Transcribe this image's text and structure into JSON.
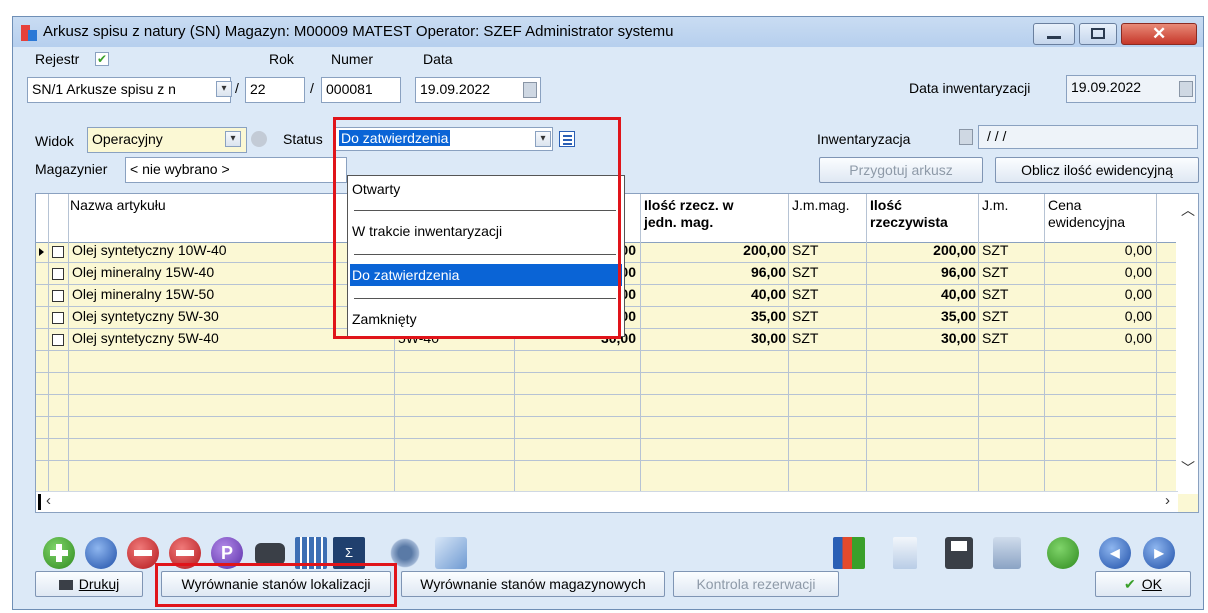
{
  "window": {
    "title": "Arkusz spisu z natury (SN)  Magazyn: M00009 MATEST  Operator: SZEF Administrator systemu"
  },
  "header": {
    "rejestr_label": "Rejestr",
    "rejestr_value": "SN/1 Arkusze spisu z n",
    "rok_label": "Rok",
    "rok_value": "22",
    "numer_label": "Numer",
    "numer_value": "000081",
    "data_label": "Data",
    "data_value": "19.09.2022",
    "data_inw_label": "Data inwentaryzacji",
    "data_inw_value": "19.09.2022",
    "slash1": "/",
    "slash2": "/"
  },
  "filters": {
    "widok_label": "Widok",
    "widok_value": "Operacyjny",
    "status_label": "Status",
    "status_value": "Do zatwierdzenia",
    "magazynier_label": "Magazynier",
    "magazynier_value": "< nie wybrano >",
    "inwentaryzacja_label": "Inwentaryzacja",
    "inwentaryzacja_value": "/ / /"
  },
  "actions": {
    "przygotuj": "Przygotuj arkusz",
    "oblicz": "Oblicz ilość ewidencyjną"
  },
  "status_dropdown": {
    "options": [
      "Otwarty",
      "W trakcie inwentaryzacji",
      "Do zatwierdzenia",
      "Zamknięty"
    ],
    "selected_index": 2
  },
  "table": {
    "columns": {
      "nazwa": "Nazwa artykułu",
      "ilosc_mag_l1": "Ilość rzecz. w",
      "ilosc_mag_l2": "jedn. mag.",
      "jm_mag": "J.m.mag.",
      "ilosc_rz_l1": "Ilość",
      "ilosc_rz_l2": "rzeczywista",
      "jm": "J.m.",
      "cena_l1": "Cena",
      "cena_l2": "ewidencyjna"
    },
    "rows": [
      {
        "nazwa": "Olej syntetyczny 10W-40",
        "kod": "",
        "ilosc_ew": "00",
        "ilosc_mag": "200,00",
        "jm_mag": "SZT",
        "ilosc_rz": "200,00",
        "jm": "SZT",
        "cena": "0,00"
      },
      {
        "nazwa": "Olej mineralny 15W-40",
        "kod": "",
        "ilosc_ew": "00",
        "ilosc_mag": "96,00",
        "jm_mag": "SZT",
        "ilosc_rz": "96,00",
        "jm": "SZT",
        "cena": "0,00"
      },
      {
        "nazwa": "Olej mineralny 15W-50",
        "kod": "",
        "ilosc_ew": "00",
        "ilosc_mag": "40,00",
        "jm_mag": "SZT",
        "ilosc_rz": "40,00",
        "jm": "SZT",
        "cena": "0,00"
      },
      {
        "nazwa": "Olej syntetyczny 5W-30",
        "kod": "",
        "ilosc_ew": "00",
        "ilosc_mag": "35,00",
        "jm_mag": "SZT",
        "ilosc_rz": "35,00",
        "jm": "SZT",
        "cena": "0,00"
      },
      {
        "nazwa": "Olej syntetyczny 5W-40",
        "kod": "5W-40",
        "ilosc_ew": "30,00",
        "ilosc_mag": "30,00",
        "jm_mag": "SZT",
        "ilosc_rz": "30,00",
        "jm": "SZT",
        "cena": "0,00"
      }
    ]
  },
  "bottom": {
    "drukuj": "Drukuj",
    "wyr_lok": "Wyrównanie stanów lokalizacji",
    "wyr_mag": "Wyrównanie stanów magazynowych",
    "kontrola": "Kontrola rezerwacji",
    "ok": "OK"
  },
  "colors": {
    "highlight": "#e0141a",
    "selection": "#0a64d6",
    "grid_bg": "#fbf8d4",
    "window_bg": "#dce9f7"
  },
  "icons": {
    "toolbar_left": [
      "add-icon",
      "preview-icon",
      "delete-icon",
      "delete-check-icon",
      "p-icon",
      "binoculars-icon",
      "grid-icon",
      "sum-icon",
      "gears-icon",
      "export-icon"
    ],
    "toolbar_right": [
      "chart-icon",
      "document-icon",
      "save-icon",
      "copy-icon",
      "refresh-icon",
      "prev-icon",
      "next-icon"
    ]
  }
}
